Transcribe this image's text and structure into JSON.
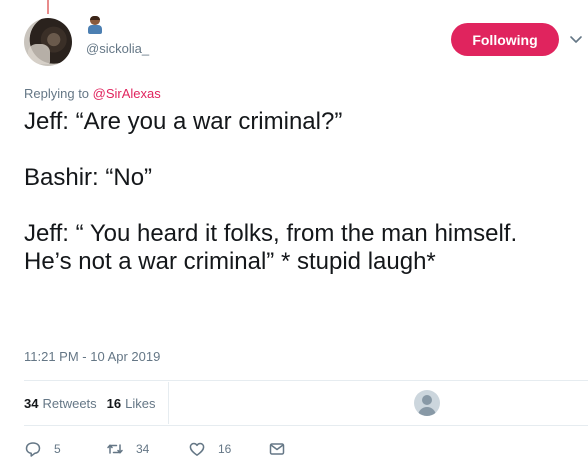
{
  "user": {
    "handle": "@sickolia_"
  },
  "follow_button": {
    "label": "Following"
  },
  "reply": {
    "prefix": "Replying to ",
    "mention": "@SirAlexas"
  },
  "tweet": {
    "text": "Jeff: “Are you a war criminal?”\n\nBashir: “No”\n\nJeff: “ You heard it folks, from the man himself. He’s not a war criminal” * stupid laugh*",
    "timestamp": "11:21 PM - 10 Apr 2019"
  },
  "stats": {
    "retweets_count": "34",
    "retweets_label": "Retweets",
    "likes_count": "16",
    "likes_label": "Likes"
  },
  "actions": {
    "replies": "5",
    "retweets": "34",
    "likes": "16"
  },
  "icons": {
    "reply": "reply-icon",
    "retweet": "retweet-icon",
    "like": "heart-icon",
    "dm": "envelope-icon",
    "menu": "chevron-down-icon"
  },
  "colors": {
    "accent": "#e0245e",
    "muted": "#657786",
    "text": "#14171a"
  }
}
